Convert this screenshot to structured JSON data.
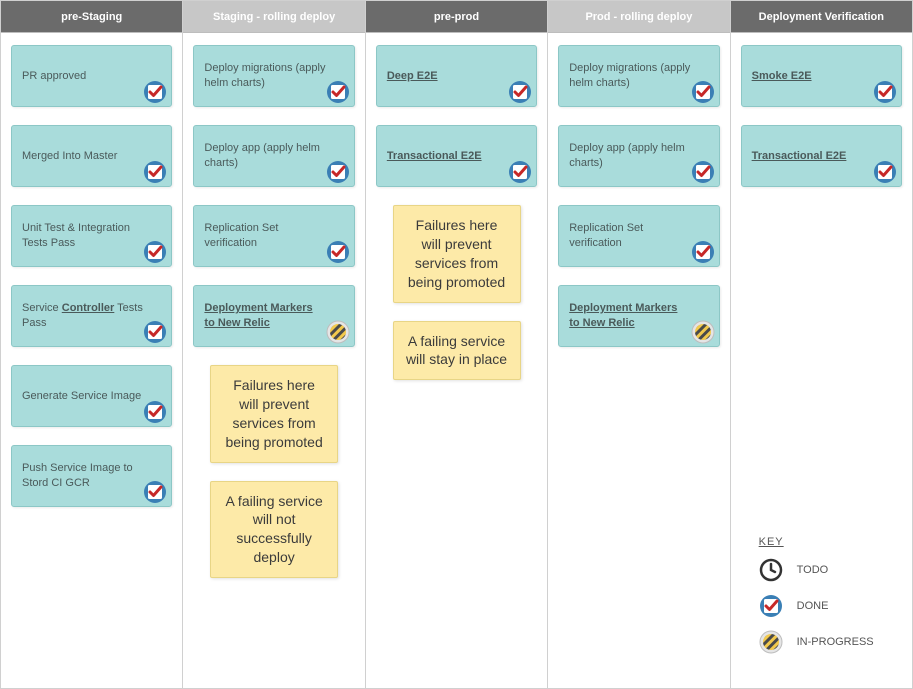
{
  "key": {
    "title": "KEY",
    "todo": "TODO",
    "done": "DONE",
    "inprogress": "IN-PROGRESS"
  },
  "columns": [
    {
      "title": "pre-Staging",
      "header_style": "dark",
      "items": [
        {
          "kind": "card",
          "label": "PR approved",
          "status": "done"
        },
        {
          "kind": "card",
          "label": "Merged Into Master",
          "status": "done"
        },
        {
          "kind": "card",
          "label": "Unit Test &\nIntegration Tests Pass",
          "status": "done"
        },
        {
          "kind": "card",
          "label_html": "Service <span class='bold'>Controller</span> Tests Pass",
          "status": "done"
        },
        {
          "kind": "card",
          "label": "Generate Service Image",
          "status": "done"
        },
        {
          "kind": "card",
          "label": "Push Service Image to Stord CI GCR",
          "status": "done"
        }
      ]
    },
    {
      "title": "Staging - rolling deploy",
      "header_style": "light",
      "items": [
        {
          "kind": "card",
          "label": "Deploy migrations (apply helm charts)",
          "status": "done"
        },
        {
          "kind": "card",
          "label": "Deploy app (apply helm charts)",
          "status": "done"
        },
        {
          "kind": "card",
          "label": "Replication Set verification",
          "status": "done"
        },
        {
          "kind": "card",
          "label_html": "<span class='bold'>Deployment Markers to New Relic</span>",
          "status": "inprogress"
        },
        {
          "kind": "note",
          "text": "Failures here will prevent services from being promoted"
        },
        {
          "kind": "note",
          "text": "A failing service will not successfully deploy"
        }
      ]
    },
    {
      "title": "pre-prod",
      "header_style": "dark",
      "items": [
        {
          "kind": "card",
          "label_html": "<span class='bold'>Deep E2E</span>",
          "status": "done"
        },
        {
          "kind": "card",
          "label_html": "<span class='bold'>Transactional E2E</span>",
          "status": "done"
        },
        {
          "kind": "note",
          "text": "Failures here will prevent services from being promoted"
        },
        {
          "kind": "note",
          "text": "A failing service will stay in place"
        }
      ]
    },
    {
      "title": "Prod - rolling deploy",
      "header_style": "light",
      "items": [
        {
          "kind": "card",
          "label": "Deploy migrations (apply helm charts)",
          "status": "done"
        },
        {
          "kind": "card",
          "label": "Deploy app (apply helm charts)",
          "status": "done"
        },
        {
          "kind": "card",
          "label": "Replication Set verification",
          "status": "done"
        },
        {
          "kind": "card",
          "label_html": "<span class='bold'>Deployment Markers to New Relic</span>",
          "status": "inprogress"
        }
      ]
    },
    {
      "title": "Deployment Verification",
      "header_style": "dark",
      "items": [
        {
          "kind": "card",
          "label_html": "<span class='bold'>Smoke E2E</span>",
          "status": "done"
        },
        {
          "kind": "card",
          "label_html": "<span class='bold'>Transactional E2E</span>",
          "status": "done"
        }
      ]
    }
  ]
}
